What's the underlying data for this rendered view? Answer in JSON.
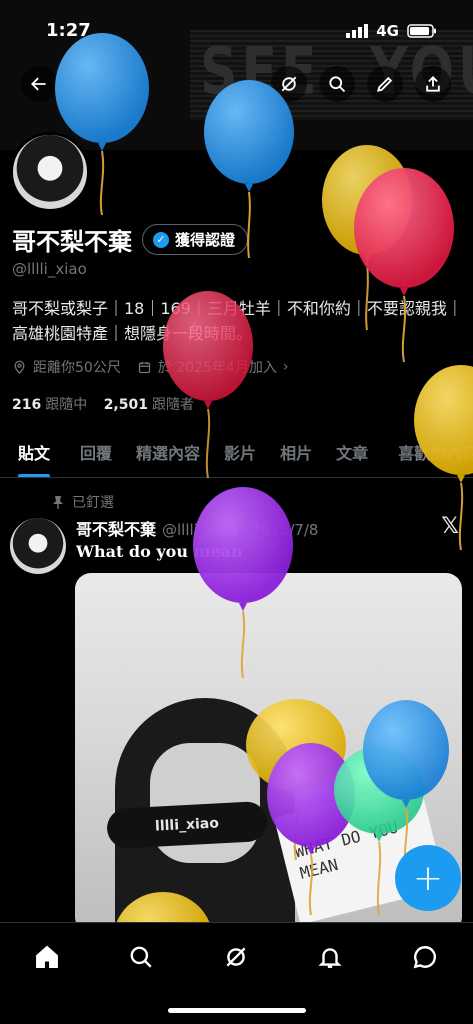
{
  "status_bar": {
    "time": "1:27",
    "network": "4G"
  },
  "banner": {
    "text_left": "SEE",
    "text_right": "YOU"
  },
  "profile": {
    "name": "哥不梨不棄",
    "verify_label": "獲得認證",
    "handle": "@lllli_xiao",
    "bio": "哥不梨或梨子｜18｜169｜三月牡羊｜不和你約｜不要認親我｜高雄桃園特產｜想隱身一段時間。",
    "location": "距離你50公尺",
    "joined": "於 2025年4月加入",
    "following_count": "216",
    "following_label": "跟隨中",
    "followers_count": "2,501",
    "followers_label": "跟隨者"
  },
  "tabs": [
    "貼文",
    "回覆",
    "精選內容",
    "影片",
    "相片",
    "文章",
    "喜歡的內容"
  ],
  "post": {
    "pinned_label": "已釘選",
    "author": "哥不梨不棄",
    "meta": "@lllli_xiao · 2025/7/8",
    "text": "What do you mean",
    "image_watermark": "lllli_xiao",
    "sign_text": "WHAT DO YOU MEAN"
  },
  "fab_label": "+",
  "colors": {
    "accent": "#1d9bf0",
    "background": "#000000",
    "muted": "#71767b"
  }
}
